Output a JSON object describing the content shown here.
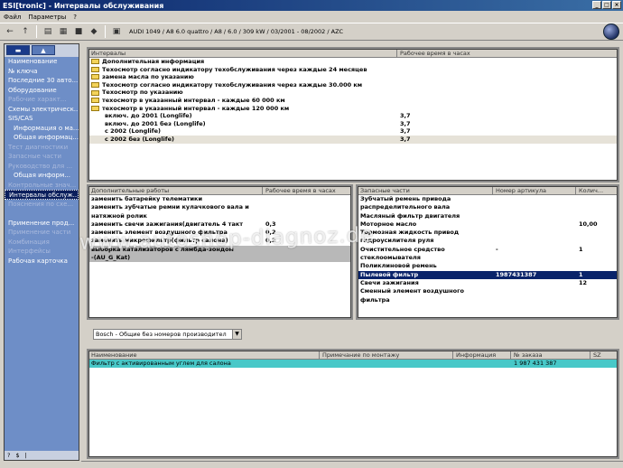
{
  "window": {
    "title": "ESI[tronic] - Интервалы обслуживания"
  },
  "menu": {
    "file": "Файл",
    "params": "Параметры",
    "help": "?"
  },
  "toolbar": {
    "vehicle": "AUDI 1049 / A8 6.0 quattro / A8 / 6.0 / 309 kW / 03/2001 - 08/2002 / AZC"
  },
  "sidebar": {
    "items": [
      {
        "label": "Наименование",
        "state": "normal"
      },
      {
        "label": "№ ключа",
        "state": "normal"
      },
      {
        "label": "Последние 30 авто...",
        "state": "normal"
      },
      {
        "label": "Оборудование",
        "state": "normal"
      },
      {
        "label": "Рабочие характ...",
        "state": "disabled"
      },
      {
        "label": "Схемы электрическ...",
        "state": "normal"
      },
      {
        "label": "SIS/CAS",
        "state": "normal"
      },
      {
        "label": "Информация о ма...",
        "state": "indent"
      },
      {
        "label": "Общая информац...",
        "state": "indent"
      },
      {
        "label": "Тест диагностики",
        "state": "disabled"
      },
      {
        "label": "Запасные части",
        "state": "disabled"
      },
      {
        "label": "Руководство для ...",
        "state": "disabled"
      },
      {
        "label": "Общая информ...",
        "state": "indent"
      },
      {
        "label": "Контрольные знач...",
        "state": "disabled"
      },
      {
        "label": "Интервалы обслуж...",
        "state": "selected"
      },
      {
        "label": "Пояснения по схе...",
        "state": "disabled"
      },
      {
        "label": "",
        "state": "disabled"
      },
      {
        "label": "Применение прод...",
        "state": "normal"
      },
      {
        "label": "Применение части",
        "state": "disabled"
      },
      {
        "label": "Комбинация",
        "state": "disabled"
      },
      {
        "label": "Интерфейсы",
        "state": "disabled"
      },
      {
        "label": "Рабочая карточка",
        "state": "normal"
      }
    ],
    "bottom": [
      "?",
      "$",
      "|"
    ]
  },
  "intervals": {
    "col_name": "Интервалы",
    "col_hours": "Рабочее время в часах",
    "rows": [
      {
        "name": "Дополнительная информация",
        "folder": true,
        "bold": true,
        "hours": ""
      },
      {
        "name": "Техосмотр согласно индикатору техобслуживания через каждые 24 месяцев",
        "folder": true,
        "bold": true,
        "hours": ""
      },
      {
        "name": "замена масла по указанию",
        "folder": true,
        "bold": true,
        "hours": ""
      },
      {
        "name": "Техосмотр согласно индикатору техобслуживания через каждые 30.000 км",
        "folder": true,
        "bold": true,
        "hours": ""
      },
      {
        "name": "Техосмотр по указанию",
        "folder": true,
        "bold": true,
        "hours": ""
      },
      {
        "name": "техосмотр в указанный интервал - каждые 60 000 км",
        "folder": true,
        "bold": true,
        "hours": ""
      },
      {
        "name": "техосмотр в указанный интервал - каждые 120 000 км",
        "folder": true,
        "bold": true,
        "hours": ""
      },
      {
        "name": "включ. до 2001 (Longlife)",
        "folder": false,
        "bold": true,
        "hours": "3,7"
      },
      {
        "name": "включ. до 2001 без (Longlife)",
        "folder": false,
        "bold": true,
        "hours": "3,7"
      },
      {
        "name": "с 2002 (Longlife)",
        "folder": false,
        "bold": true,
        "hours": "3,7"
      },
      {
        "name": "с 2002 без (Longlife)",
        "folder": false,
        "bold": true,
        "hours": "3,7",
        "highlight": true
      }
    ]
  },
  "works": {
    "col_name": "Дополнительные работы",
    "col_hours": "Рабочее время в часах",
    "rows": [
      {
        "name": "заменить батарейку телематики",
        "hours": ""
      },
      {
        "name": "заменить зубчатые ремни кулачкового вала и",
        "hours": ""
      },
      {
        "name": "натяжной ролик",
        "hours": ""
      },
      {
        "name": "заменить свечи зажигания(двигатель 4 такт",
        "hours": "0,3"
      },
      {
        "name": "заменить элемент воздушного фильтра",
        "hours": "0,2"
      },
      {
        "name": "заменить микрофильтр(фильтр салона)",
        "hours": "0,2"
      },
      {
        "name": "выборка катализаторов с лямбда-зондом",
        "hours": "",
        "gray": true
      },
      {
        "name": "-(AU_G_Kat)",
        "hours": "",
        "gray": true
      }
    ]
  },
  "parts": {
    "col_name": "Запасные части",
    "col_article": "Номер артикула",
    "col_qty": "Колич...",
    "rows": [
      {
        "name": "Зубчатый ремень привода",
        "article": "",
        "qty": ""
      },
      {
        "name": "распределительного вала",
        "article": "",
        "qty": ""
      },
      {
        "name": "Масляный фильтр двигателя",
        "article": "",
        "qty": ""
      },
      {
        "name": "Моторное масло",
        "article": "",
        "qty": "10,00"
      },
      {
        "name": "Тормозная жидкость привод",
        "article": "",
        "qty": ""
      },
      {
        "name": "гидроусилителя руля",
        "article": "",
        "qty": ""
      },
      {
        "name": "Очистительное средство",
        "article": "-",
        "qty": "1"
      },
      {
        "name": "стеклоомывателя",
        "article": "",
        "qty": ""
      },
      {
        "name": "Поликлиновой ремень",
        "article": "",
        "qty": ""
      },
      {
        "name": "Пылевой фильтр",
        "article": "1987431387",
        "qty": "1",
        "selected": true
      },
      {
        "name": "Свечи зажигания",
        "article": "",
        "qty": "12"
      },
      {
        "name": "Сменный элемент воздушного",
        "article": "",
        "qty": ""
      },
      {
        "name": "фильтра",
        "article": "",
        "qty": ""
      }
    ]
  },
  "filter": {
    "selected": "Bosch - Общие без номеров производител"
  },
  "bottom_table": {
    "cols": [
      "Наименование",
      "Примечание по монтажу",
      "Информация",
      "№ заказа",
      "SZ"
    ],
    "rows": [
      {
        "cells": [
          "Фильтр с активированным углем для салона",
          "",
          "",
          "1 987 431 387",
          ""
        ]
      }
    ]
  },
  "watermark": "www.autoshop-diagnoz.de",
  "colors": {
    "sidebar": "#6e8ec7",
    "selection": "#0a246a",
    "highlight": "#48c8c8"
  }
}
